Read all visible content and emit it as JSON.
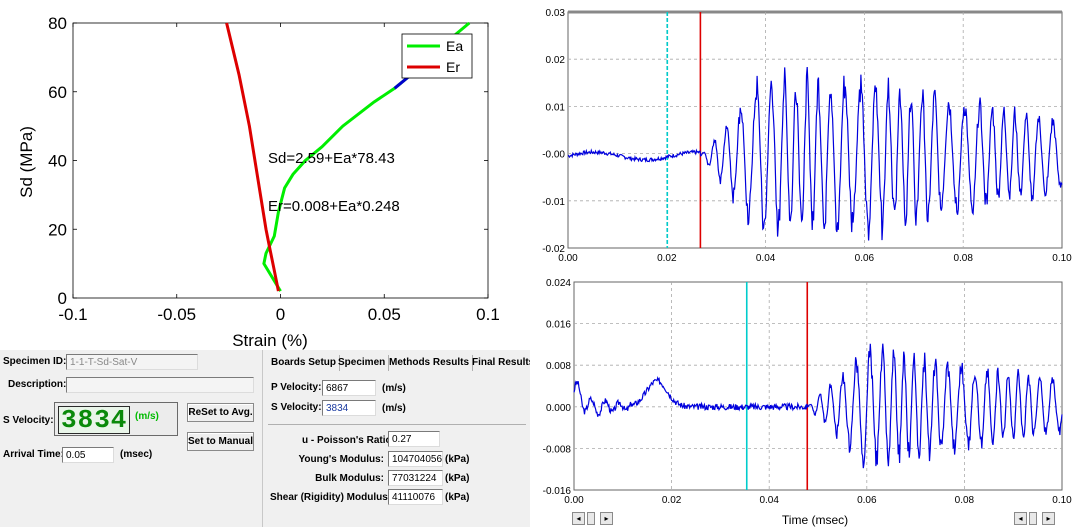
{
  "stress_strain_chart": {
    "ylabel": "Sd  (MPa)",
    "xlabel": "Strain (%)",
    "y_ticks": [
      "0",
      "20",
      "40",
      "60",
      "80"
    ],
    "x_ticks": [
      "-0.1",
      "-0.05",
      "0",
      "0.05",
      "0.1"
    ],
    "legend": [
      {
        "name": "Ea",
        "color": "#00ee00"
      },
      {
        "name": "Er",
        "color": "#dd0000"
      }
    ],
    "annotations": [
      "Sd=2.59+Ea*78.43",
      "Er=0.008+Ea*0.248"
    ],
    "fit_segment_color": "#0000cc"
  },
  "chart_data": [
    {
      "type": "line",
      "xlabel": "Strain (%)",
      "ylabel": "Sd  (MPa)",
      "xlim": [
        -0.1,
        0.1
      ],
      "ylim": [
        0,
        80
      ],
      "series": [
        {
          "name": "Ea",
          "color": "#00ee00",
          "x": [
            0.0,
            -0.004,
            -0.008,
            -0.007,
            -0.003,
            -0.001,
            0.002,
            0.006,
            0.012,
            0.02,
            0.03,
            0.045,
            0.055,
            0.065,
            0.075,
            0.083,
            0.091
          ],
          "y": [
            2,
            6,
            10,
            13,
            18,
            25,
            32,
            36,
            40,
            44,
            50,
            57,
            61,
            66,
            71,
            76,
            80
          ]
        },
        {
          "name": "Er",
          "color": "#dd0000",
          "x": [
            -0.001,
            -0.003,
            -0.005,
            -0.007,
            -0.011,
            -0.015,
            -0.02,
            -0.026
          ],
          "y": [
            2,
            8,
            14,
            20,
            35,
            50,
            65,
            80
          ]
        }
      ]
    },
    {
      "type": "line",
      "xlabel": "",
      "ylabel": "",
      "xlim": [
        0,
        0.1
      ],
      "ylim": [
        -0.02,
        0.03
      ],
      "x_ticks": [
        "0.00",
        "0.02",
        "0.04",
        "0.06",
        "0.08",
        "0.10"
      ],
      "y_ticks": [
        "0.03",
        "0.02",
        "0.01",
        "-0.00",
        "-0.01",
        "-0.02"
      ],
      "markers": [
        {
          "x": 0.0201,
          "color": "#00cccc"
        },
        {
          "x": 0.0268,
          "color": "#dd0000"
        }
      ],
      "series": [
        {
          "color": "#0000dd",
          "description_only": false
        }
      ]
    },
    {
      "type": "line",
      "xlabel": "Time (msec)",
      "ylabel": "",
      "xlim": [
        0,
        0.1
      ],
      "ylim": [
        -0.016,
        0.024
      ],
      "x_ticks": [
        "0.00",
        "0.02",
        "0.04",
        "0.06",
        "0.08",
        "0.10"
      ],
      "y_ticks": [
        "0.024",
        "0.016",
        "0.008",
        "0.000",
        "-0.008",
        "-0.016"
      ],
      "markers": [
        {
          "x": 0.0354,
          "color": "#00cccc"
        },
        {
          "x": 0.0478,
          "color": "#dd0000"
        }
      ],
      "series": [
        {
          "color": "#0000dd"
        }
      ]
    }
  ],
  "form": {
    "specimen_id_label": "Specimen ID:",
    "specimen_id_value": "1-1-T-Sd-Sat-V",
    "description_label": "Description:",
    "description_value": "",
    "s_velocity_label": "S Velocity:",
    "s_velocity_display": "3834",
    "s_velocity_unit": "(m/s)",
    "arrival_time_label": "Arrival Time:",
    "arrival_time_value": "0.05",
    "arrival_time_unit": "(msec)",
    "reset_button": "ReSet to Avg.",
    "manual_button": "Set to Manual"
  },
  "results": {
    "tabs": [
      "Boards Setup",
      "Specimen",
      "Methods Results",
      "Final Results"
    ],
    "p_velocity_label": "P Velocity:",
    "p_velocity_value": "6867",
    "p_velocity_unit": "(m/s)",
    "s_velocity_label": "S Velocity:",
    "s_velocity_value": "3834",
    "s_velocity_unit": "(m/s)",
    "poisson_label": "u - Poisson's Ratio:",
    "poisson_value": "0.27",
    "youngs_label": "Young's Modulus:",
    "youngs_value": "104704056",
    "youngs_unit": "(kPa)",
    "bulk_label": "Bulk Modulus:",
    "bulk_value": "77031224",
    "bulk_unit": "(kPa)",
    "shear_label": "Shear (Rigidity) Modulus:",
    "shear_value": "41110076",
    "shear_unit": "(kPa)"
  },
  "waveform": {
    "time_label": "Time (msec)"
  }
}
